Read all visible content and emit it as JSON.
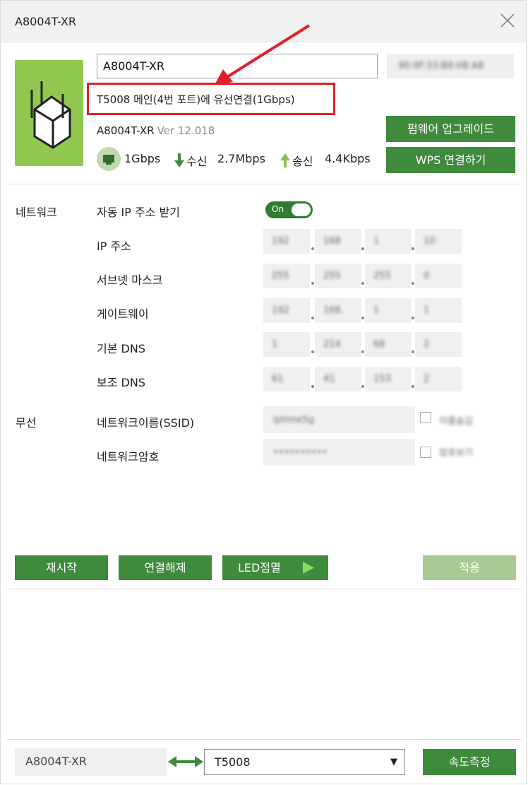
{
  "window": {
    "title": "A8004T-XR",
    "close_icon": "close-icon"
  },
  "device": {
    "icon": "router-icon",
    "name_value": "A8004T-XR",
    "mac_address": "90:9F:33:B8:0B:A8",
    "connection_text": "T5008 메인(4번 포트)에 유선연결(1Gbps)",
    "model": "A8004T-XR",
    "version": "Ver 12.018",
    "firmware_button": "펌웨어 업그레이드",
    "wps_button": "WPS 연결하기",
    "link_speed": "1Gbps",
    "rx_label": "수신",
    "rx_value": "2.7Mbps",
    "tx_label": "송신",
    "tx_value": "4.4Kbps",
    "annotation_color": "#e0202a"
  },
  "network": {
    "section_label": "네트워크",
    "auto_ip_label": "자동 IP 주소 받기",
    "auto_ip_toggle": "On",
    "ip_label": "IP 주소",
    "ip": [
      "192",
      "168",
      "1",
      "10"
    ],
    "subnet_label": "서브넷 마스크",
    "subnet": [
      "255",
      "255",
      "255",
      "0"
    ],
    "gateway_label": "게이트웨이",
    "gateway": [
      "192",
      "168",
      "1",
      "1"
    ],
    "dns1_label": "기본 DNS",
    "dns1": [
      "1",
      "214",
      "68",
      "2"
    ],
    "dns2_label": "보조 DNS",
    "dns2": [
      "61",
      "41",
      "153",
      "2"
    ]
  },
  "wireless": {
    "section_label": "무선",
    "ssid_label": "네트워크이름(SSID)",
    "ssid_value": "iptime5g",
    "ssid_checkbox_label": "이름숨김",
    "password_label": "네트워크암호",
    "password_value": "••••••••••",
    "password_checkbox_label": "암호보기"
  },
  "actions": {
    "restart": "재시작",
    "disconnect": "연결해제",
    "led_blink": "LED점멸",
    "apply": "적용"
  },
  "footer": {
    "extender_name": "A8004T-XR",
    "router_select": "T5008",
    "speed_test": "속도측정"
  },
  "colors": {
    "green": "#3f8a3c",
    "device_green": "#90c74f",
    "apply_disabled": "#a9c995"
  }
}
